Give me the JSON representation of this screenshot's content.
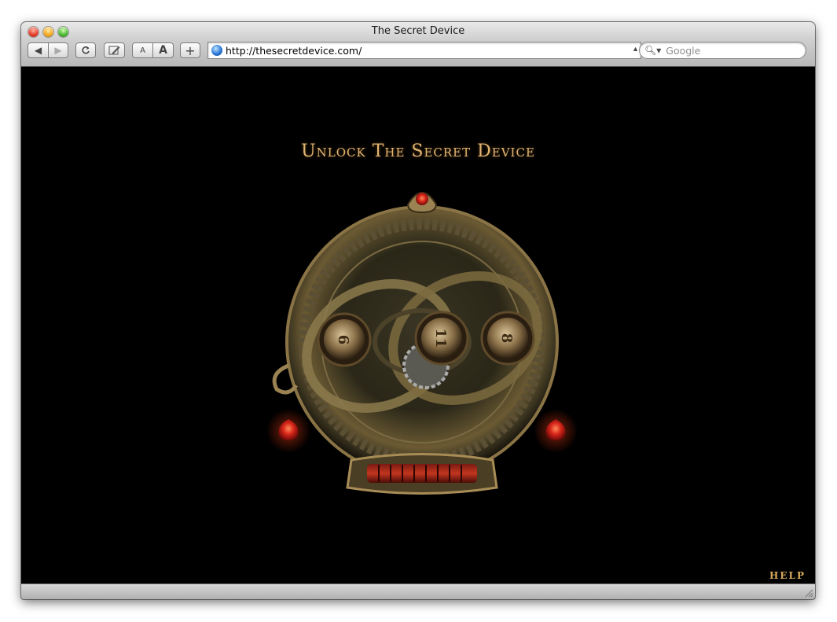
{
  "window": {
    "title": "The Secret Device"
  },
  "toolbar": {
    "back_icon": "back-arrow-icon",
    "forward_icon": "forward-arrow-icon",
    "reload_icon": "reload-icon",
    "edit_icon": "edit-icon",
    "text_smaller_label": "A",
    "text_larger_label": "A",
    "add_bookmark_label": "+",
    "url": "http://thesecretdevice.com/",
    "search_placeholder": "Google"
  },
  "page": {
    "title": "Unlock The Secret Device",
    "dials": [
      "6",
      "11",
      "8"
    ],
    "help_label": "HELP"
  },
  "colors": {
    "title_gold": "#e2b572",
    "help_gold": "#d9a95a",
    "gem_red": "#d8261a",
    "page_bg": "#000000"
  }
}
